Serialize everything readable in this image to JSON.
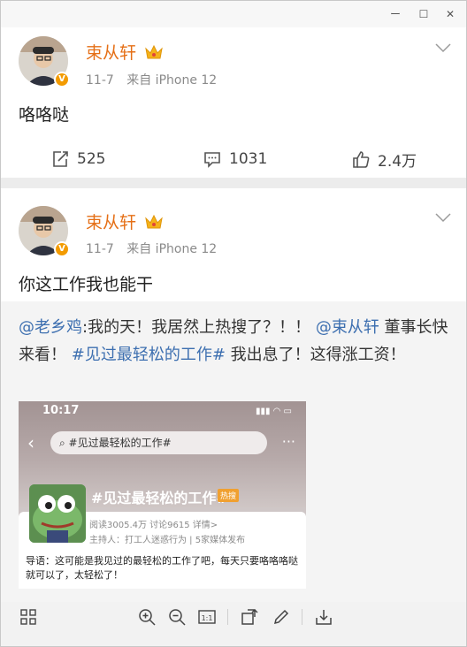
{
  "window": {
    "controls": {
      "minimize": "ー",
      "maximize": "☐",
      "close": "✕"
    }
  },
  "colors": {
    "name": "#e56f16",
    "link": "#3d6fb0",
    "badge": "#f39b00"
  },
  "posts": [
    {
      "author": "束从轩",
      "date": "11-7",
      "source": "来自 iPhone 12",
      "text": "咯咯哒",
      "actions": {
        "repost": "525",
        "comment": "1031",
        "like": "2.4万"
      }
    },
    {
      "author": "束从轩",
      "date": "11-7",
      "source": "来自 iPhone 12",
      "text": "你这工作我也能干"
    }
  ],
  "repost": {
    "mention1": "@老乡鸡",
    "text1": ":我的天！我居然上热搜了？！！",
    "mention2": "@束从轩",
    "text2": " 董事长快来看！",
    "topic": "#见过最轻松的工作#",
    "text3": " 我出息了！这得涨工资！"
  },
  "screenshot": {
    "time": "10:17",
    "search_text": "#见过最轻松的工作#",
    "title": "#见过最轻松的工作#",
    "hot_badge": "热搜",
    "stats": "阅读3005.4万  讨论9615  详情>",
    "host": "主持人：打工人迷惑行为 | 5家媒体发布",
    "intro": "导语：这可能是我见过的最轻松的工作了吧，每天只要咯咯咯哒就可以了，太轻松了！",
    "zoom_label": "1:1"
  },
  "icons": [
    "grid-icon",
    "zoom-in-icon",
    "zoom-out-icon",
    "actual-size-icon",
    "rotate-icon",
    "edit-icon",
    "download-icon"
  ]
}
